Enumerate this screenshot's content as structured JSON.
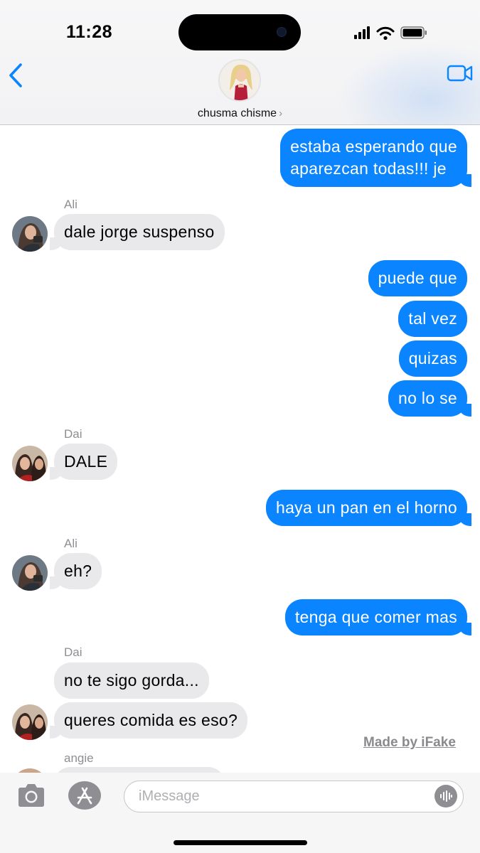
{
  "status_bar": {
    "time": "11:28"
  },
  "header": {
    "contact_name": "chusma chisme",
    "chevron": "›",
    "back_icon": "chevron-left-icon",
    "video_icon": "video-camera-icon"
  },
  "colors": {
    "outgoing": "#0a84ff",
    "incoming": "#e9e9eb",
    "accent": "#0a84ff"
  },
  "messages": [
    {
      "direction": "out",
      "text": "estaba esperando que aparezcan todas!!! je"
    },
    {
      "direction": "in",
      "sender": "Ali",
      "text": "dale jorge suspenso"
    },
    {
      "direction": "out",
      "text": "puede que"
    },
    {
      "direction": "out",
      "text": "tal vez"
    },
    {
      "direction": "out",
      "text": "quizas"
    },
    {
      "direction": "out",
      "text": "no lo se"
    },
    {
      "direction": "in",
      "sender": "Dai",
      "text": "DALE"
    },
    {
      "direction": "out",
      "text": "haya un pan en el horno"
    },
    {
      "direction": "in",
      "sender": "Ali",
      "text": "eh?"
    },
    {
      "direction": "out",
      "text": "tenga que comer mas"
    },
    {
      "direction": "in",
      "sender": "Dai",
      "text": "no te sigo gorda..."
    },
    {
      "direction": "in",
      "sender": "Dai",
      "text": "queres comida es eso?"
    },
    {
      "direction": "in",
      "sender": "angie",
      "text": ""
    }
  ],
  "message_lines": {
    "first": [
      "estaba esperando que",
      "aparezcan todas!!! je"
    ]
  },
  "watermark": "Made by iFake",
  "input": {
    "placeholder": "iMessage"
  }
}
